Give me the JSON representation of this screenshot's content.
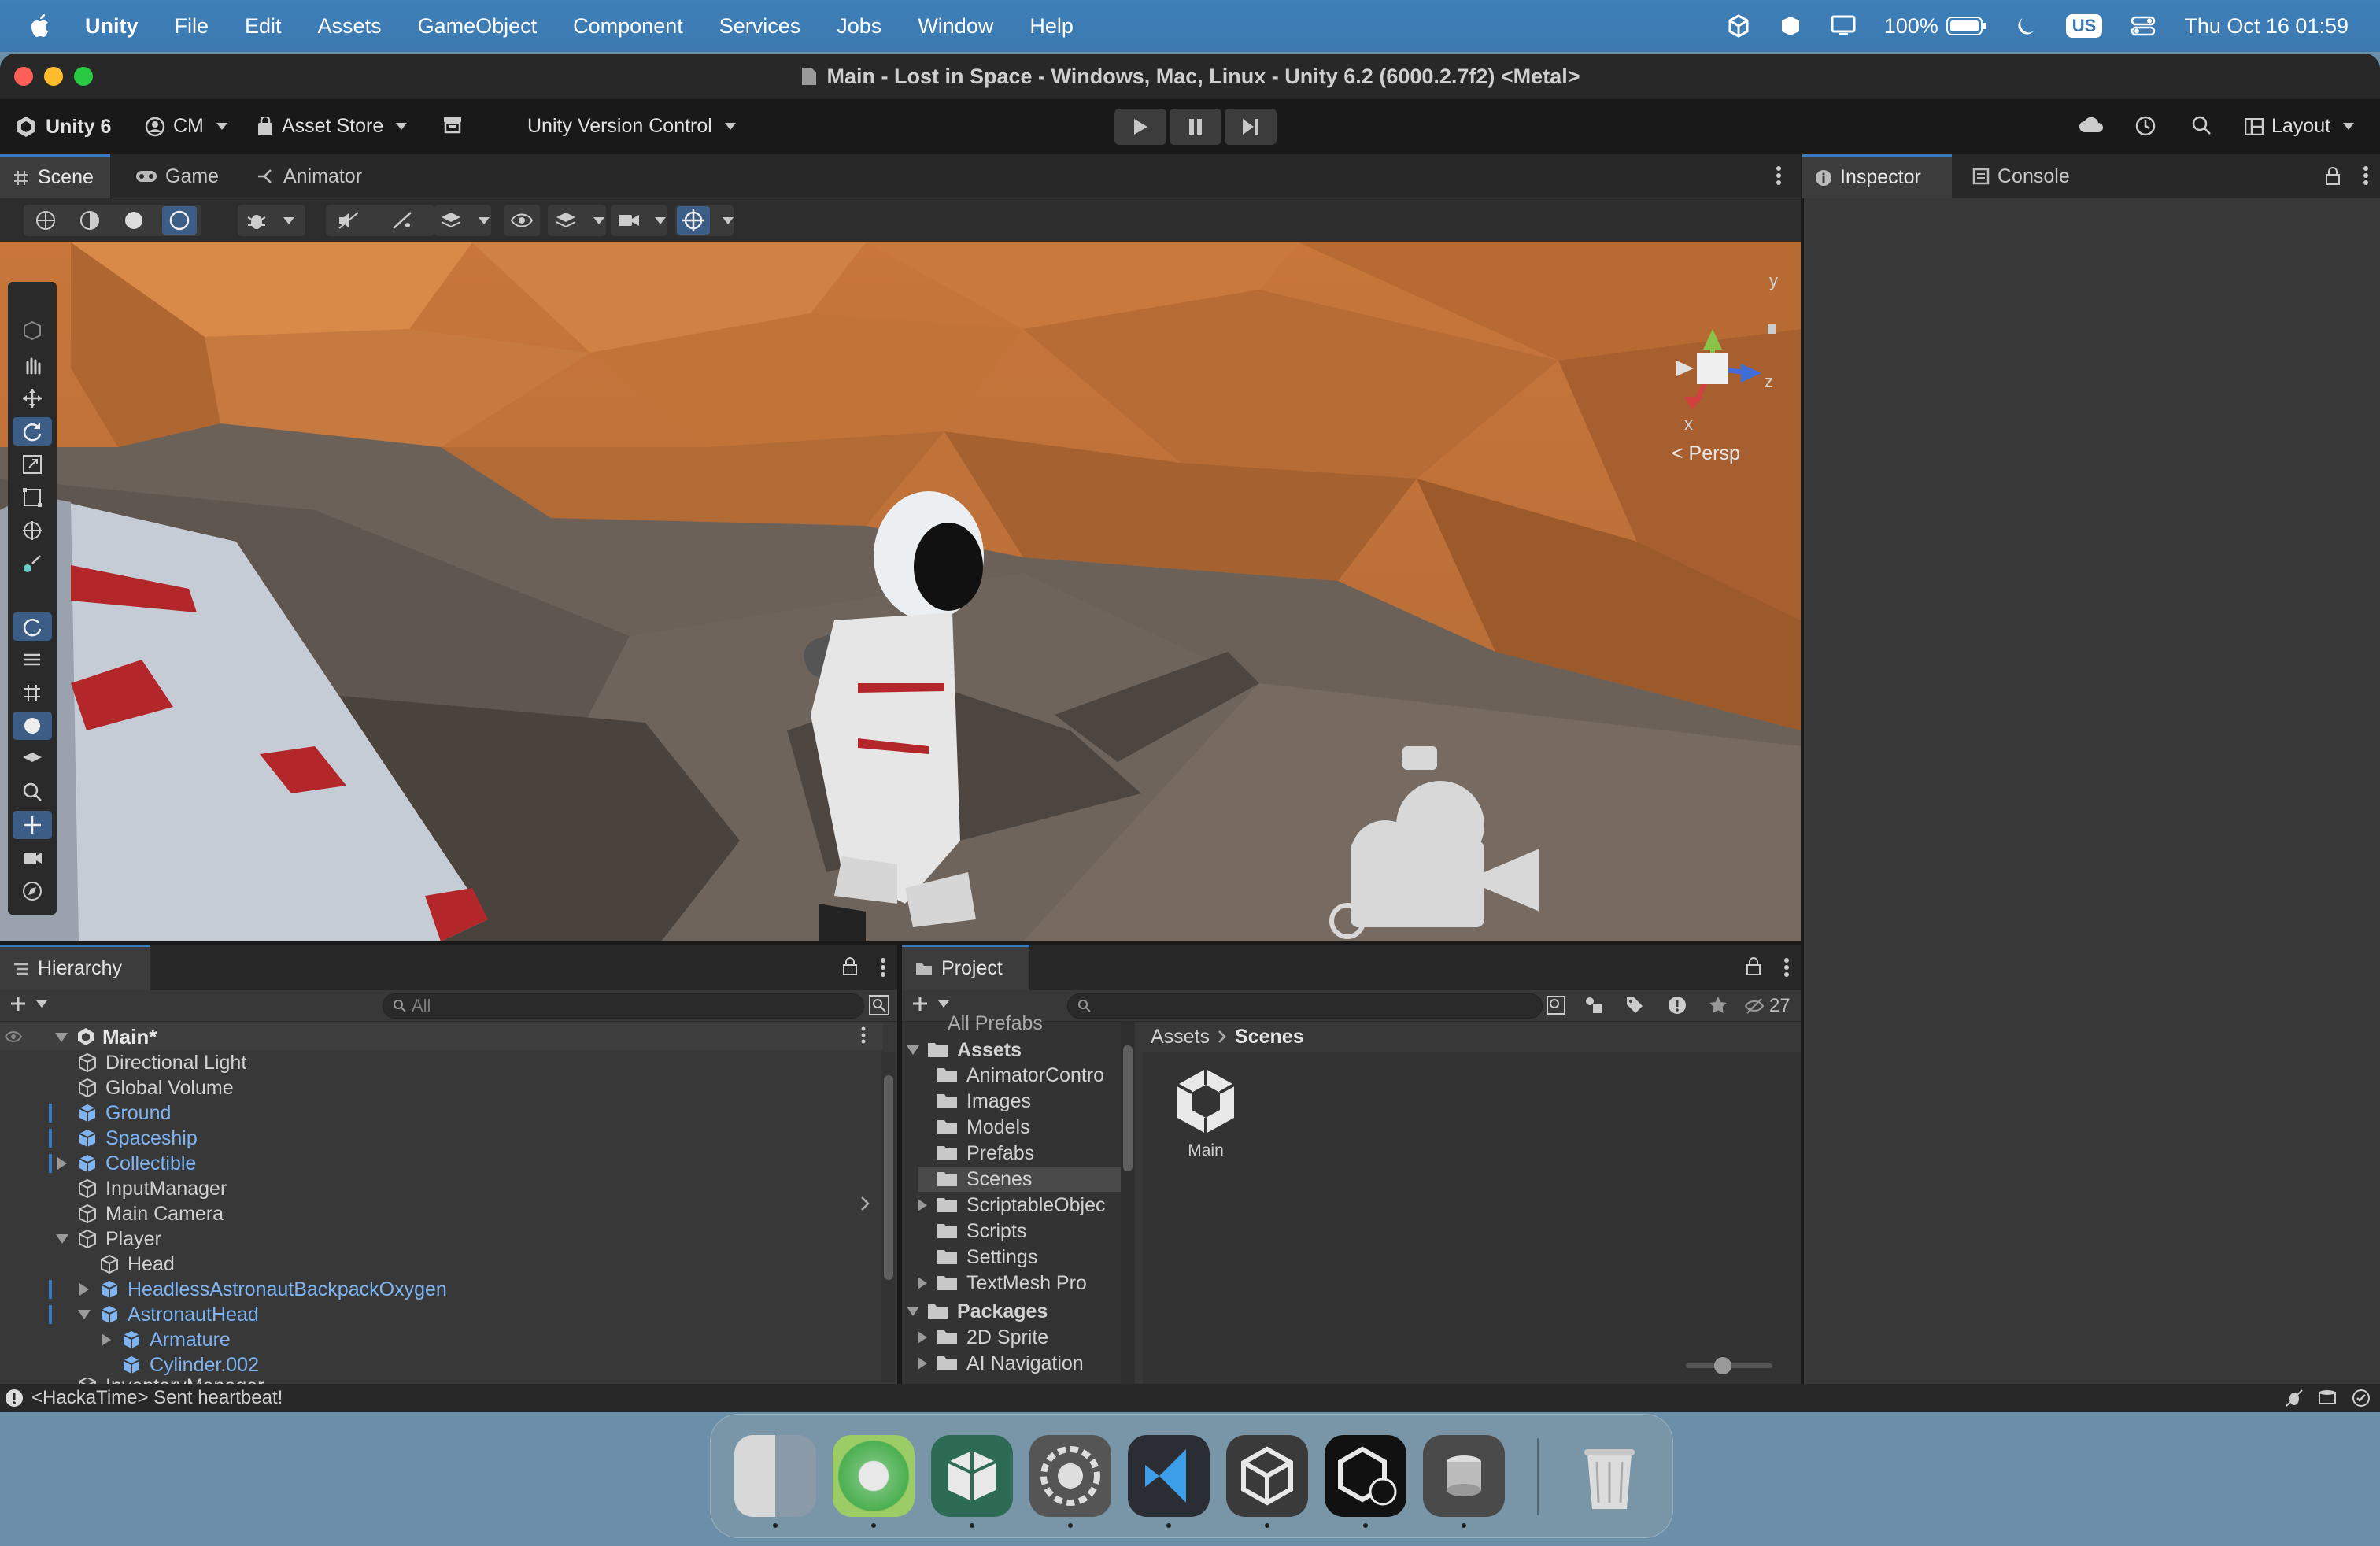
{
  "menubar": {
    "app": "Unity",
    "items": [
      "File",
      "Edit",
      "Assets",
      "GameObject",
      "Component",
      "Services",
      "Jobs",
      "Window",
      "Help"
    ],
    "battery": "100%",
    "input_source": "US",
    "clock": "Thu Oct 16  01:59"
  },
  "window": {
    "title": "Main - Lost in Space - Windows, Mac, Linux - Unity 6.2 (6000.2.7f2) <Metal>"
  },
  "toolbar": {
    "unity_version": "Unity 6",
    "account": "CM",
    "asset_store": "Asset Store",
    "version_control": "Unity Version Control",
    "layout": "Layout"
  },
  "scene_tabs": [
    "Scene",
    "Game",
    "Animator"
  ],
  "gizmo": {
    "y": "y",
    "z": "z",
    "x": "x",
    "persp": "Persp"
  },
  "inspector_tabs": [
    "Inspector",
    "Console"
  ],
  "hierarchy": {
    "title": "Hierarchy",
    "search_placeholder": "All",
    "scene": "Main*",
    "rows": [
      {
        "label": "Directional Light",
        "prefab": false
      },
      {
        "label": "Global Volume",
        "prefab": false
      },
      {
        "label": "Ground",
        "prefab": true
      },
      {
        "label": "Spaceship",
        "prefab": true
      },
      {
        "label": "Collectible",
        "prefab": true
      },
      {
        "label": "InputManager",
        "prefab": false
      },
      {
        "label": "Main Camera",
        "prefab": false
      },
      {
        "label": "Player",
        "prefab": false
      },
      {
        "label": "Head",
        "prefab": false
      },
      {
        "label": "HeadlessAstronautBackpackOxygen",
        "prefab": true
      },
      {
        "label": "AstronautHead",
        "prefab": true
      },
      {
        "label": "Armature",
        "prefab": true
      },
      {
        "label": "Cylinder.002",
        "prefab": true
      },
      {
        "label": "InventoryManager",
        "prefab": false
      }
    ]
  },
  "project": {
    "title": "Project",
    "hidden_count": "27",
    "partial_top": "All Prefabs",
    "assets_label": "Assets",
    "asset_folders": [
      "AnimatorContro",
      "Images",
      "Models",
      "Prefabs",
      "Scenes",
      "ScriptableObjec",
      "Scripts",
      "Settings",
      "TextMesh Pro"
    ],
    "packages_label": "Packages",
    "package_folders": [
      "2D Sprite",
      "AI Navigation"
    ],
    "breadcrumb": [
      "Assets",
      "Scenes"
    ],
    "grid_items": [
      "Main"
    ]
  },
  "status": {
    "message": "<HackaTime> Sent heartbeat!"
  }
}
